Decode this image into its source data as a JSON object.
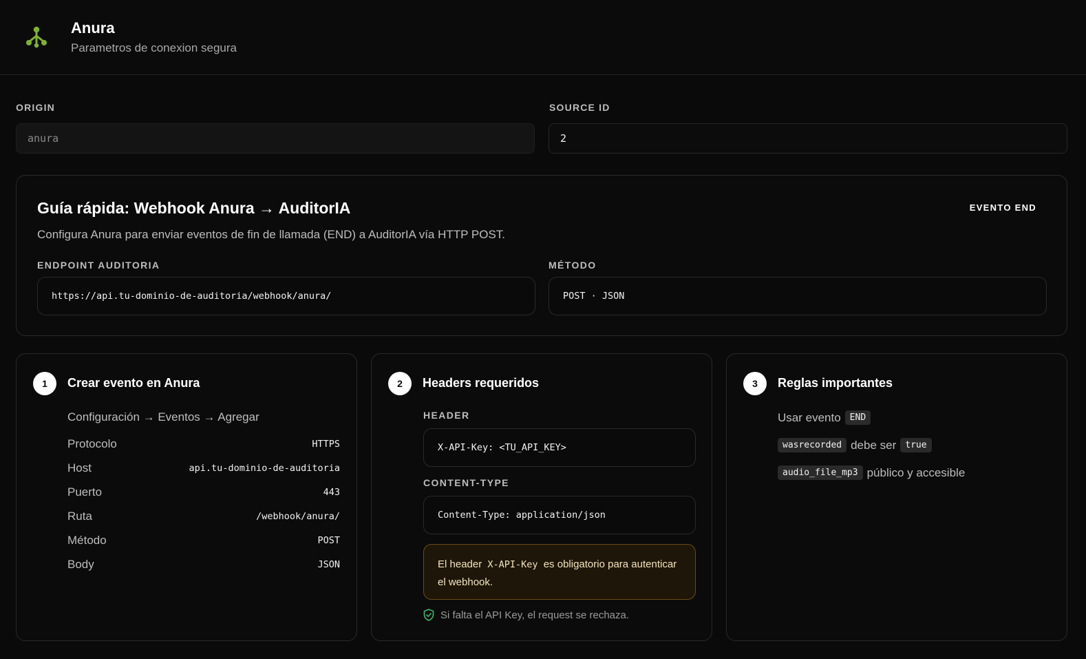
{
  "app": {
    "title": "Anura",
    "subtitle": "Parametros de conexion segura",
    "logo_icon": "anura-frog-icon",
    "accent": "#7fb32e"
  },
  "fields": {
    "origin": {
      "label": "ORIGIN",
      "value": "anura"
    },
    "source_id": {
      "label": "SOURCE ID",
      "value": "2"
    }
  },
  "guide": {
    "title": "Guía rápida: Webhook Anura → AuditorIA",
    "badge": "EVENTO END",
    "description": "Configura Anura para enviar eventos de fin de llamada (END) a AuditorIA vía HTTP POST.",
    "endpoint_label": "ENDPOINT AUDITORIA",
    "endpoint_value": "https://api.tu-dominio-de-auditoria/webhook/anura/",
    "method_label": "MÉTODO",
    "method_value": "POST · JSON"
  },
  "step1": {
    "number": "1",
    "title": "Crear evento en Anura",
    "path": "Configuración → Eventos → Agregar",
    "rows": [
      {
        "key": "Protocolo",
        "value": "HTTPS"
      },
      {
        "key": "Host",
        "value": "api.tu-dominio-de-auditoria"
      },
      {
        "key": "Puerto",
        "value": "443"
      },
      {
        "key": "Ruta",
        "value": "/webhook/anura/"
      },
      {
        "key": "Método",
        "value": "POST"
      },
      {
        "key": "Body",
        "value": "JSON"
      }
    ]
  },
  "step2": {
    "number": "2",
    "title": "Headers requeridos",
    "header_label": "HEADER",
    "header_value": "X-API-Key: <TU_API_KEY>",
    "content_type_label": "CONTENT-TYPE",
    "content_type_value": "Content-Type: application/json",
    "warning_prefix": "El header",
    "warning_code": "X-API-Key",
    "warning_suffix": "es obligatorio para autenticar el webhook.",
    "note": "Si falta el API Key, el request se rechaza.",
    "note_icon": "shield-check-icon",
    "note_icon_color": "#3fb96b"
  },
  "step3": {
    "number": "3",
    "title": "Reglas importantes",
    "rule1_text": "Usar evento",
    "rule1_chip": "END",
    "rule2_chip": "wasrecorded",
    "rule2_text": "debe ser",
    "rule2_chip2": "true",
    "rule3_chip": "audio_file_mp3",
    "rule3_text": "público y accesible"
  }
}
